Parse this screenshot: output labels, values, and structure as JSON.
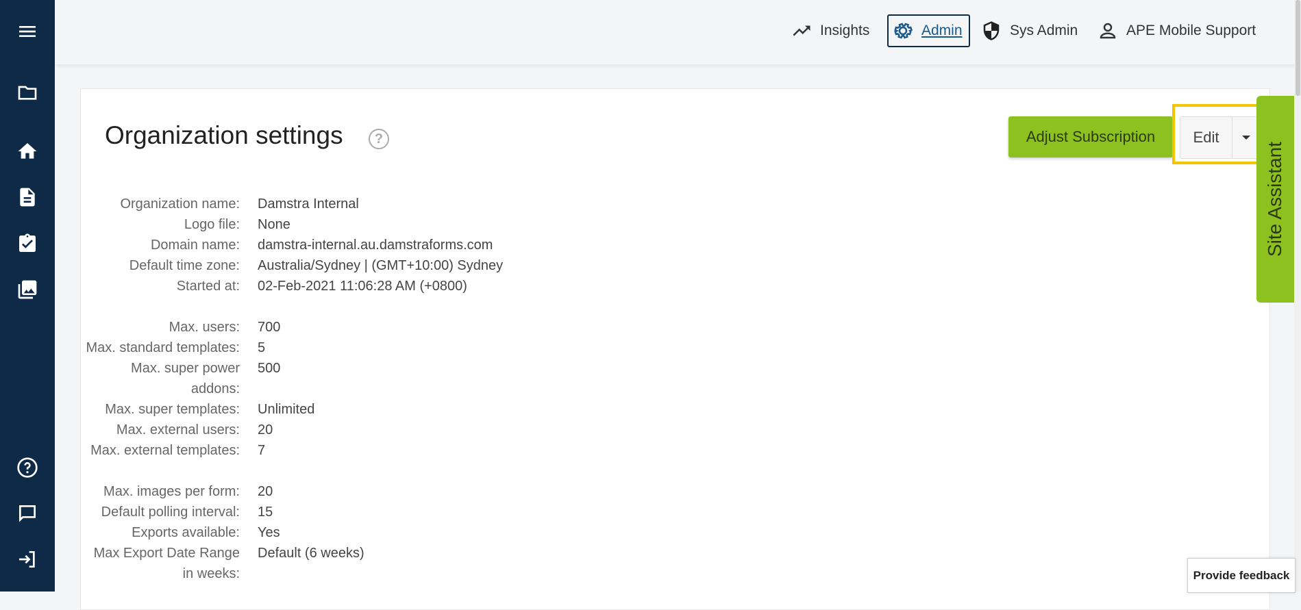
{
  "sidebar": {
    "items": [
      {
        "name": "menu-icon"
      },
      {
        "name": "folder-icon"
      },
      {
        "name": "home-icon"
      },
      {
        "name": "document-icon"
      },
      {
        "name": "clipboard-check-icon"
      },
      {
        "name": "photo-library-icon"
      },
      {
        "name": "help-icon"
      },
      {
        "name": "chat-icon"
      },
      {
        "name": "logout-icon"
      }
    ],
    "background": "#0e2a47"
  },
  "topnav": {
    "insights": "Insights",
    "admin": "Admin",
    "sysadmin": "Sys Admin",
    "user": "APE Mobile Support"
  },
  "page": {
    "title": "Organization settings",
    "help_symbol": "?",
    "adjust_subscription": "Adjust Subscription",
    "edit": "Edit"
  },
  "settings": {
    "group1": [
      {
        "label": "Organization name:",
        "value": "Damstra Internal"
      },
      {
        "label": "Logo file:",
        "value": "None"
      },
      {
        "label": "Domain name:",
        "value": "damstra-internal.au.damstraforms.com"
      },
      {
        "label": "Default time zone:",
        "value": "Australia/Sydney | (GMT+10:00) Sydney"
      },
      {
        "label": "Started at:",
        "value": "02-Feb-2021 11:06:28 AM (+0800)"
      }
    ],
    "group2": [
      {
        "label": "Max. users:",
        "value": "700"
      },
      {
        "label": "Max. standard templates:",
        "value": "5"
      },
      {
        "label": "Max. super power addons:",
        "value": "500"
      },
      {
        "label": "Max. super templates:",
        "value": "Unlimited"
      },
      {
        "label": "Max. external users:",
        "value": "20"
      },
      {
        "label": "Max. external templates:",
        "value": "7"
      }
    ],
    "group3": [
      {
        "label": "Max. images per form:",
        "value": "20"
      },
      {
        "label": "Default polling interval:",
        "value": "15"
      },
      {
        "label": "Exports available:",
        "value": "Yes"
      },
      {
        "label": "Max Export Date Range in weeks:",
        "value": "Default (6 weeks)"
      }
    ]
  },
  "site_assistant": "Site Assistant",
  "feedback": "Provide feedback",
  "colors": {
    "accent": "#8cc11f",
    "highlight": "#f5c400",
    "nav": "#0e2a47"
  }
}
